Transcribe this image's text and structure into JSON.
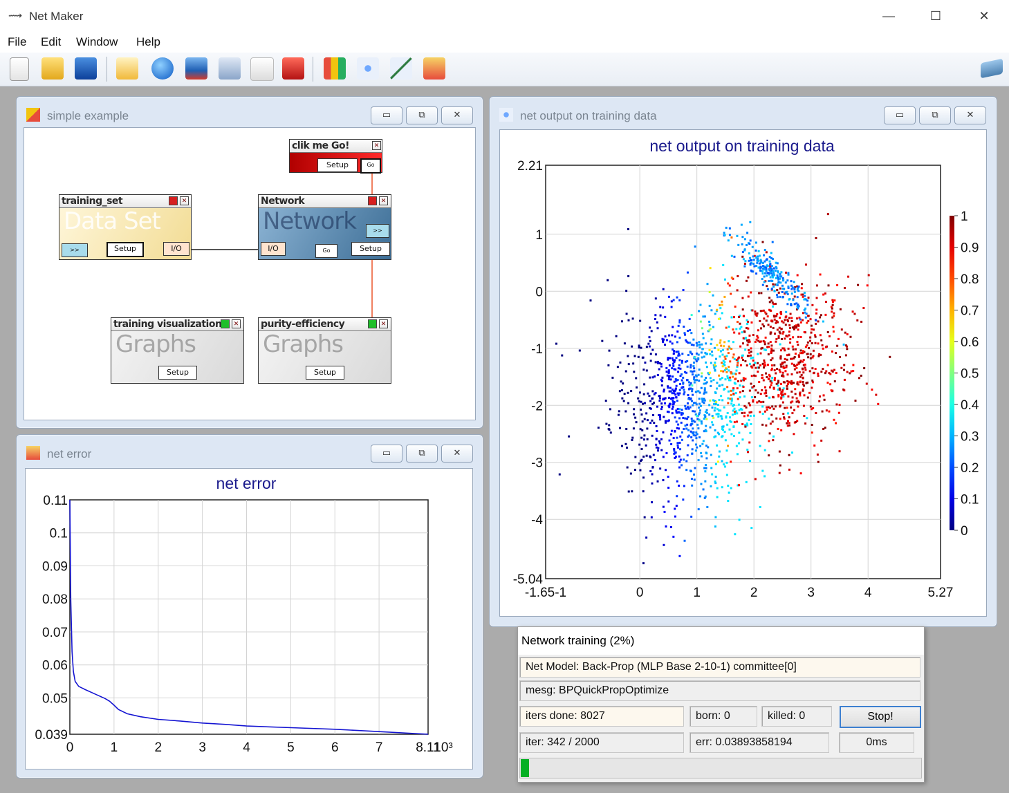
{
  "app": {
    "title": "Net Maker"
  },
  "menu": [
    "File",
    "Edit",
    "Window",
    "Help"
  ],
  "toolbar_icons": [
    "new-file-icon",
    "open-folder-icon",
    "save-icon",
    "open-net-icon",
    "globe-icon",
    "database-icon",
    "calculator-icon",
    "graph-page-icon",
    "stop-media-icon",
    "bar-chart-icon",
    "scatter-icon",
    "line-chart-icon",
    "area-chart-icon",
    "book-icon"
  ],
  "windows": {
    "simple": {
      "title": "simple example",
      "nodes": {
        "go": {
          "title": "clik me Go!",
          "setup": "Setup",
          "go": "Go"
        },
        "training_set": {
          "title": "training_set",
          "watermark": "Data Set",
          "arrow": ">>",
          "setup": "Setup",
          "io": "I/O"
        },
        "network": {
          "title": "Network",
          "watermark": "Network",
          "arrow": ">>",
          "io": "I/O",
          "go": "Go",
          "setup": "Setup"
        },
        "training_vis": {
          "title": "training visualization",
          "watermark": "Graphs",
          "setup": "Setup"
        },
        "purity": {
          "title": "purity-efficiency",
          "watermark": "Graphs",
          "setup": "Setup"
        }
      }
    },
    "net_output": {
      "title": "net output on training data"
    },
    "net_error": {
      "title": "net error"
    }
  },
  "colors": {
    "mdi_bg": "#ababab",
    "chart_title": "#1a1a8c",
    "progress": "#06b025"
  },
  "chart_data": [
    {
      "type": "scatter",
      "title": "net output on training data",
      "xlim": [
        -1.65,
        5.27
      ],
      "ylim": [
        -5.04,
        2.21
      ],
      "x_tick_labels": [
        "-1.65-1",
        "0",
        "1",
        "2",
        "3",
        "4",
        "5.27"
      ],
      "x_tick_values": [
        -1.65,
        0,
        1,
        2,
        3,
        4,
        5.27
      ],
      "y_tick_labels": [
        "2.21",
        "1",
        "0",
        "-1",
        "-2",
        "-3",
        "-4",
        "-5.04"
      ],
      "y_tick_values": [
        2.21,
        1,
        0,
        -1,
        -2,
        -3,
        -4,
        -5.04
      ],
      "colorbar": {
        "min": 0,
        "max": 1,
        "labels": [
          "1",
          "0.9",
          "0.8",
          "0.7",
          "0.6",
          "0.5",
          "0.4",
          "0.3",
          "0.2",
          "0.1",
          "0"
        ]
      },
      "clusters": [
        {
          "name": "",
          "n": 900,
          "cx": 0.8,
          "cy": -1.9,
          "sx": 0.65,
          "sy": 0.85,
          "value": "blue-to-cyan"
        },
        {
          "name": "",
          "n": 750,
          "cx": 2.5,
          "cy": -1.2,
          "sx": 0.6,
          "sy": 0.75,
          "value": "orange-to-red"
        },
        {
          "name": "",
          "n": 220,
          "cx": 2.3,
          "cy": 0.3,
          "sx": 0.35,
          "sy": 0.15,
          "value": "cyan-band"
        }
      ],
      "grid": true
    },
    {
      "type": "line",
      "title": "net error",
      "xlim": [
        0,
        8.11
      ],
      "ylim": [
        0.039,
        0.11
      ],
      "x_tick_labels": [
        "0",
        "1",
        "2",
        "3",
        "4",
        "5",
        "6",
        "7",
        "8.11",
        "10³"
      ],
      "x_tick_values": [
        0,
        1,
        2,
        3,
        4,
        5,
        6,
        7,
        8.11
      ],
      "y_tick_labels": [
        "0.11",
        "0.1",
        "0.09",
        "0.08",
        "0.07",
        "0.06",
        "0.05",
        "0.039"
      ],
      "y_tick_values": [
        0.11,
        0.1,
        0.09,
        0.08,
        0.07,
        0.06,
        0.05,
        0.039
      ],
      "series": [
        {
          "name": "",
          "x": [
            0,
            0.02,
            0.05,
            0.08,
            0.12,
            0.2,
            0.35,
            0.6,
            0.8,
            0.9,
            1.0,
            1.1,
            1.3,
            1.6,
            2.0,
            2.5,
            3.0,
            3.5,
            4.0,
            5.0,
            6.0,
            7.0,
            8.11
          ],
          "y": [
            0.11,
            0.08,
            0.064,
            0.058,
            0.055,
            0.0535,
            0.0525,
            0.051,
            0.0498,
            0.049,
            0.0478,
            0.0465,
            0.0452,
            0.0443,
            0.0435,
            0.043,
            0.0424,
            0.042,
            0.0415,
            0.041,
            0.0405,
            0.0398,
            0.039
          ]
        }
      ],
      "grid": true
    }
  ],
  "training": {
    "title": "Network training (2%)",
    "model": "Net Model:  Back-Prop (MLP Base 2-10-1)   committee[0]",
    "mesg": "mesg:  BPQuickPropOptimize",
    "iters_done": "iters done:  8027",
    "born": "born:  0",
    "killed": "killed:  0",
    "stop": "Stop!",
    "iter": "iter:  342 / 2000",
    "err": "err:  0.03893858194",
    "time": "0ms",
    "progress": 0.02
  }
}
